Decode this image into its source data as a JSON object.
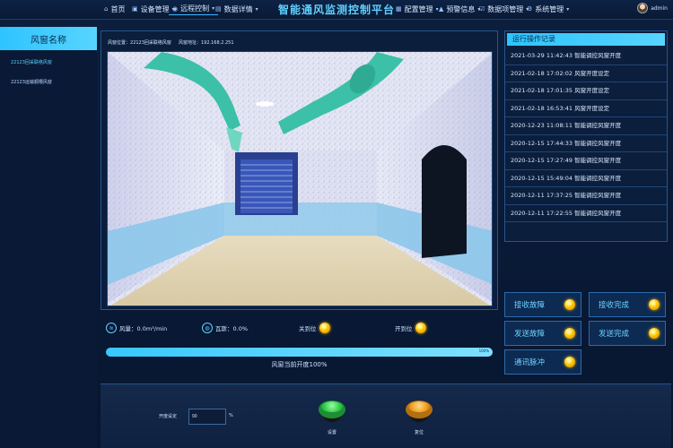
{
  "header": {
    "title": "智能通风监测控制平台",
    "nav": [
      {
        "label": "首页",
        "icon": "home-icon"
      },
      {
        "label": "设备管理",
        "icon": "device-icon"
      },
      {
        "label": "远程控制",
        "icon": "remote-icon"
      },
      {
        "label": "数据详情",
        "icon": "data-icon"
      },
      {
        "label": "配置管理",
        "icon": "config-icon"
      },
      {
        "label": "预警信息",
        "icon": "alert-icon"
      },
      {
        "label": "数据项管理",
        "icon": "data-item-icon"
      },
      {
        "label": "系统管理",
        "icon": "system-icon"
      }
    ],
    "user": "admin"
  },
  "sidebar": {
    "title": "风窗名称",
    "items": [
      {
        "label": "22123回采联络风窗"
      },
      {
        "label": "22123运输顺槽风窗"
      }
    ]
  },
  "viewer": {
    "position_label": "风窗位置：",
    "position_value": "22123回采联络风窗",
    "address_label": "风窗地址：",
    "address_value": "192.168.2.251"
  },
  "log": {
    "title": "运行操作记录",
    "rows": [
      "2021-03-29 11:42:43 智能调控风窗开度",
      "2021-02-18 17:02:02 风窗开度设定",
      "2021-02-18 17:01:35 风窗开度设定",
      "2021-02-18 16:53:41 风窗开度设定",
      "2020-12-23 11:08:11 智能调控风窗开度",
      "2020-12-15 17:44:33 智能调控风窗开度",
      "2020-12-15 17:27:49 智能调控风窗开度",
      "2020-12-15 15:49:04 智能调控风窗开度",
      "2020-12-11 17:37:25 智能调控风窗开度",
      "2020-12-11 17:22:55 智能调控风窗开度"
    ]
  },
  "status_buttons": {
    "receive_fault": "接收故障",
    "receive_done": "接收完成",
    "send_fault": "发送故障",
    "send_done": "发送完成",
    "comm_pulse": "通讯脉冲"
  },
  "readouts": {
    "airflow": "风量：0.0m³/min",
    "gas": "瓦斯：0.0%",
    "closed_limit": "关到位",
    "open_limit": "开到位"
  },
  "opening": {
    "percent": 100,
    "percent_label": "100%",
    "caption": "风窗当前开度100%"
  },
  "control": {
    "setpoint_label": "开度设定",
    "setpoint_value": "90",
    "unit": "%",
    "set_label": "设置",
    "reset_label": "复位"
  },
  "colors": {
    "accent": "#2ec4ff",
    "led": "#ffc400",
    "set_button": "#2fd04a",
    "reset_button": "#f0a020"
  }
}
